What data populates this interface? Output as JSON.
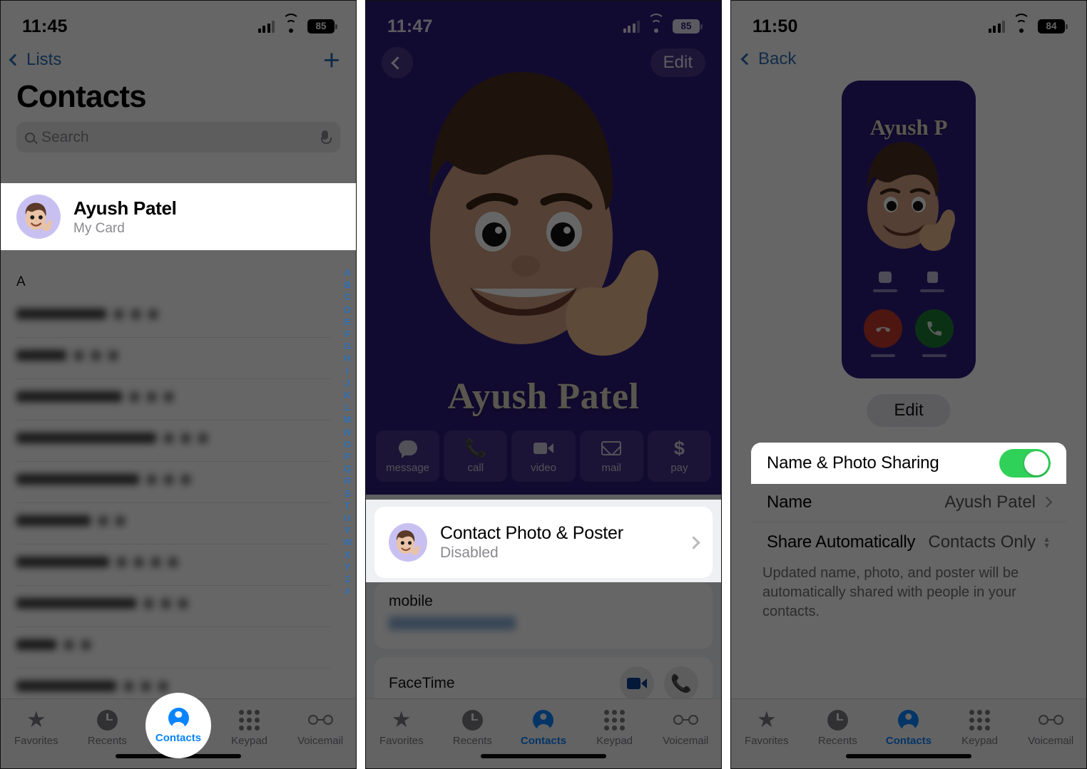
{
  "panel1": {
    "status": {
      "time": "11:45",
      "battery": "85",
      "signal_icon": "cellular-bars-icon",
      "wifi_icon": "wifi-icon",
      "battery_icon": "battery-icon"
    },
    "nav": {
      "back_label": "Lists",
      "add_label": "+"
    },
    "title": "Contacts",
    "search": {
      "placeholder": "Search",
      "search_icon": "search-icon",
      "mic_icon": "microphone-icon"
    },
    "my_card": {
      "name": "Ayush Patel",
      "subtitle": "My Card",
      "avatar_icon": "memoji-avatar"
    },
    "section_header": "A",
    "alphabet_index": [
      "A",
      "B",
      "C",
      "D",
      "E",
      "F",
      "G",
      "H",
      "I",
      "J",
      "K",
      "L",
      "M",
      "N",
      "O",
      "P",
      "Q",
      "R",
      "S",
      "T",
      "U",
      "V",
      "W",
      "X",
      "Y",
      "Z",
      "#"
    ],
    "tabs": [
      {
        "label": "Favorites",
        "icon": "star-icon",
        "active": false
      },
      {
        "label": "Recents",
        "icon": "clock-icon",
        "active": false
      },
      {
        "label": "Contacts",
        "icon": "person-circle-icon",
        "active": true
      },
      {
        "label": "Keypad",
        "icon": "keypad-icon",
        "active": false
      },
      {
        "label": "Voicemail",
        "icon": "voicemail-icon",
        "active": false
      }
    ]
  },
  "panel2": {
    "status": {
      "time": "11:47",
      "battery": "85"
    },
    "nav": {
      "back_icon": "chevron-left-icon",
      "edit_label": "Edit"
    },
    "poster_name": "Ayush Patel",
    "actions": [
      {
        "label": "message",
        "icon": "message-bubble-icon"
      },
      {
        "label": "call",
        "icon": "phone-icon"
      },
      {
        "label": "video",
        "icon": "video-camera-icon"
      },
      {
        "label": "mail",
        "icon": "envelope-icon"
      },
      {
        "label": "pay",
        "icon": "dollar-icon"
      }
    ],
    "photo_poster": {
      "title": "Contact Photo & Poster",
      "subtitle": "Disabled",
      "avatar_icon": "memoji-avatar",
      "chevron_icon": "chevron-right-icon"
    },
    "mobile_label": "mobile",
    "facetime_label": "FaceTime",
    "facetime_icons": [
      "video-camera-icon",
      "phone-icon"
    ],
    "tabs": [
      {
        "label": "Favorites",
        "active": false
      },
      {
        "label": "Recents",
        "active": false
      },
      {
        "label": "Contacts",
        "active": true
      },
      {
        "label": "Keypad",
        "active": false
      },
      {
        "label": "Voicemail",
        "active": false
      }
    ]
  },
  "panel3": {
    "status": {
      "time": "11:50",
      "battery": "84"
    },
    "nav": {
      "back_label": "Back"
    },
    "mini_poster": {
      "name": "Ayush P",
      "memoji_icon": "memoji-avatar",
      "decline_icon": "phone-down-icon",
      "accept_icon": "phone-icon",
      "message_icon": "message-bubble-icon",
      "mute_icon": "mute-icon"
    },
    "edit_label": "Edit",
    "settings": [
      {
        "label": "Name & Photo Sharing",
        "value": "",
        "control": "toggle",
        "toggle_on": true,
        "highlighted": true
      },
      {
        "label": "Name",
        "value": "Ayush Patel",
        "control": "chevron",
        "highlighted": false
      },
      {
        "label": "Share Automatically",
        "value": "Contacts Only",
        "control": "stepper",
        "highlighted": false
      }
    ],
    "footer_note": "Updated name, photo, and poster will be automatically shared with people in your contacts.",
    "tabs": [
      {
        "label": "Favorites",
        "active": false
      },
      {
        "label": "Recents",
        "active": false
      },
      {
        "label": "Contacts",
        "active": true
      },
      {
        "label": "Keypad",
        "active": false
      },
      {
        "label": "Voicemail",
        "active": false
      }
    ]
  },
  "colors": {
    "accent_blue": "#0a84ff",
    "link_blue": "#2f6fb5",
    "poster_purple": "#2e1c7a",
    "toggle_green": "#30d158",
    "avatar_purple": "#c9c0f2"
  }
}
